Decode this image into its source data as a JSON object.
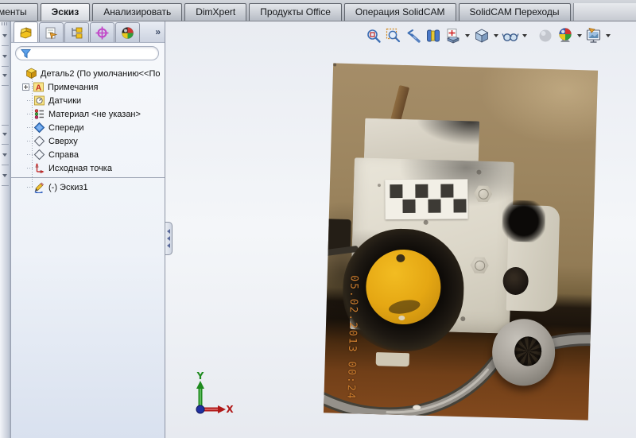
{
  "command_tabs": {
    "items": [
      "менты",
      "Эскиз",
      "Анализировать",
      "DimXpert",
      "Продукты Office",
      "Операция SolidCAM",
      "SolidCAM Переходы"
    ],
    "active": "Эскиз"
  },
  "feature_panel": {
    "tabs": [
      "featuremanager",
      "propertymanager",
      "configurationmanager",
      "dimxpertmanager",
      "displaymanager"
    ],
    "overflow_chevron": "»",
    "filter": {
      "value": "",
      "placeholder": ""
    },
    "tree": {
      "root_label": "Деталь2  (По умолчанию<<По",
      "items": [
        {
          "label": "Примечания",
          "icon": "annotations-folder-icon",
          "expandable": true
        },
        {
          "label": "Датчики",
          "icon": "sensors-folder-icon"
        },
        {
          "label": "Материал <не указан>",
          "icon": "material-icon"
        },
        {
          "label": "Спереди",
          "icon": "plane-front-icon"
        },
        {
          "label": "Сверху",
          "icon": "plane-icon"
        },
        {
          "label": "Справа",
          "icon": "plane-icon"
        },
        {
          "label": "Исходная точка",
          "icon": "origin-icon"
        },
        {
          "label": "(-) Эскиз1",
          "icon": "sketch-icon"
        }
      ]
    }
  },
  "hud_toolbar": {
    "buttons": [
      {
        "name": "zoom-to-fit"
      },
      {
        "name": "zoom-to-area"
      },
      {
        "name": "previous-view"
      },
      {
        "name": "section-view"
      },
      {
        "name": "view-orientation",
        "dropdown": true
      },
      {
        "name": "display-style",
        "dropdown": true
      },
      {
        "name": "hide-show-items",
        "dropdown": true
      },
      {
        "name": "edit-appearance",
        "disabled": true
      },
      {
        "name": "apply-scene",
        "dropdown": true
      },
      {
        "name": "view-settings",
        "dropdown": true
      }
    ]
  },
  "triad": {
    "x_label": "X",
    "y_label": "Y"
  },
  "photo": {
    "timestamp": "05.02.2013 00:24"
  },
  "colors": {
    "cap_yellow": "#e5a713",
    "part_white": "#dcd7c9",
    "wood_brown": "#9c855f",
    "floor_red_brown": "#82491d",
    "timestamp_orange": "#cf7e2e"
  }
}
